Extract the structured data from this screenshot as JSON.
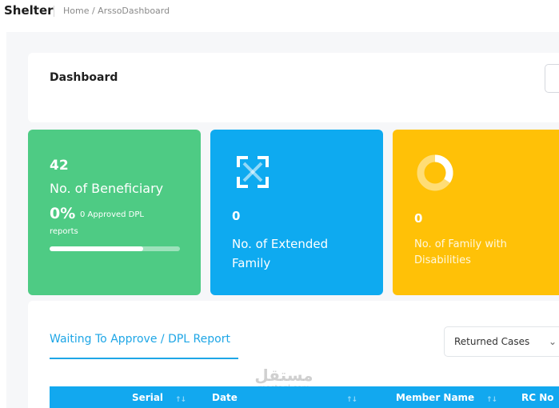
{
  "header": {
    "brand": "Shelter",
    "breadcrumb": "Home / ArssoDashboard"
  },
  "dashboard": {
    "title": "Dashboard"
  },
  "stats": {
    "beneficiary": {
      "count": "42",
      "label": "No. of Beneficiary",
      "percent": "0%",
      "approved_text": "0 Approved DPL",
      "reports_text": "reports",
      "progress": 0.72
    },
    "extended_family": {
      "count": "0",
      "label": "No. of Extended Family",
      "icon": "expand-arrows-icon"
    },
    "disabilities": {
      "count": "0",
      "label": "No. of Family with Disabilities",
      "icon": "donut-chart-icon"
    }
  },
  "table_section": {
    "tab_label": "Waiting To Approve / DPL Report",
    "filter_selected": "Returned Cases",
    "columns": [
      "Serial",
      "Date",
      "Member Name",
      "RC No"
    ]
  },
  "watermark": {
    "arabic": "مستقل",
    "latin": "mostaql.com"
  },
  "colors": {
    "green": "#4ecb84",
    "blue": "#0eaaf0",
    "yellow": "#ffc107",
    "accent": "#1ea6e6"
  }
}
